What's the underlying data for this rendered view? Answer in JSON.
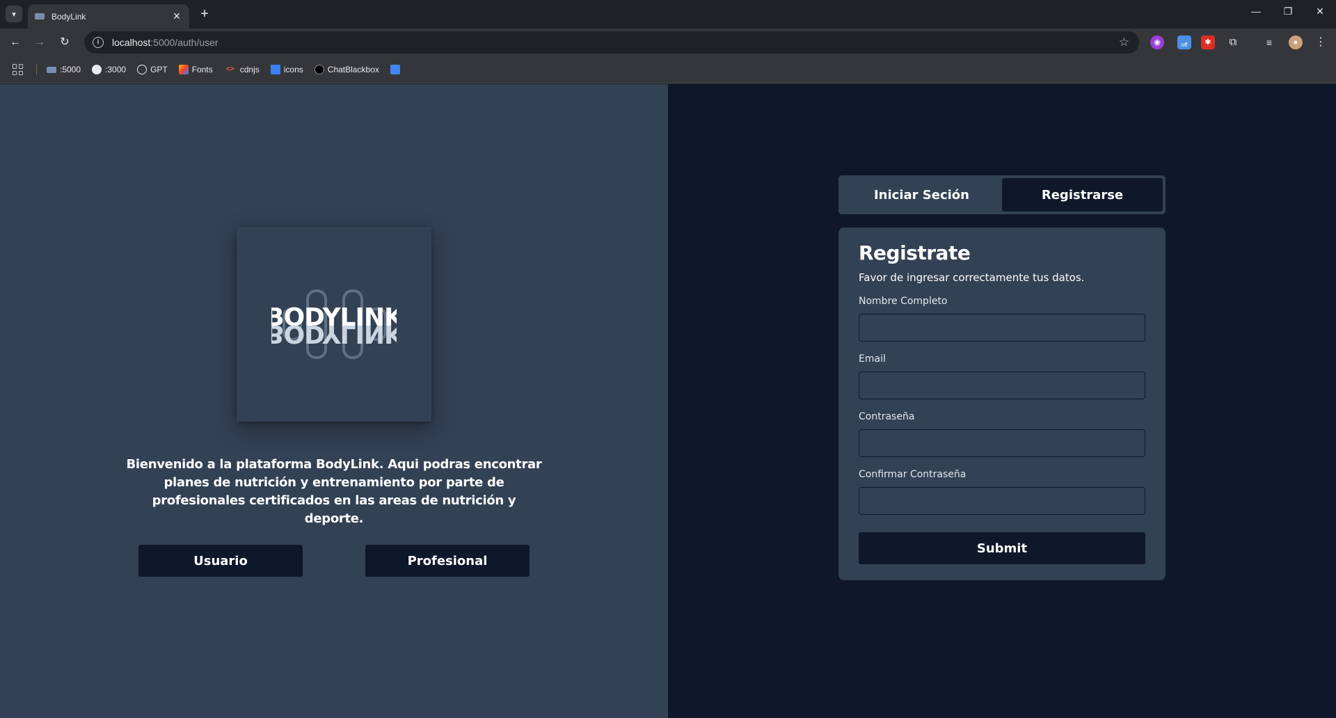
{
  "browser": {
    "tab_title": "BodyLink",
    "url_host": "localhost",
    "url_path": ":5000/auth/user",
    "bookmarks": [
      ":5000",
      ":3000",
      "GPT",
      "Fonts",
      "cdnjs",
      "icons",
      "ChatBlackbox"
    ],
    "extension_badge": "off"
  },
  "left": {
    "logo_text": "BODYLINK",
    "welcome": "Bienvenido a la plataforma BodyLink. Aqui podras encontrar planes de nutrición y entrenamiento por parte de profesionales certificados en las areas de nutrición y deporte.",
    "buttons": {
      "user": "Usuario",
      "professional": "Profesional"
    }
  },
  "auth": {
    "tabs": {
      "login": "Iniciar Seción",
      "register": "Registrarse"
    },
    "form": {
      "title": "Registrate",
      "subtitle": "Favor de ingresar correctamente tus datos.",
      "fields": [
        {
          "label": "Nombre Completo",
          "value": ""
        },
        {
          "label": "Email",
          "value": ""
        },
        {
          "label": "Contraseña",
          "value": ""
        },
        {
          "label": "Confirmar Contraseña",
          "value": ""
        }
      ],
      "submit": "Submit"
    }
  },
  "colors": {
    "left_bg": "#334155",
    "right_bg": "#0f172a",
    "button_bg": "#0f172a"
  }
}
